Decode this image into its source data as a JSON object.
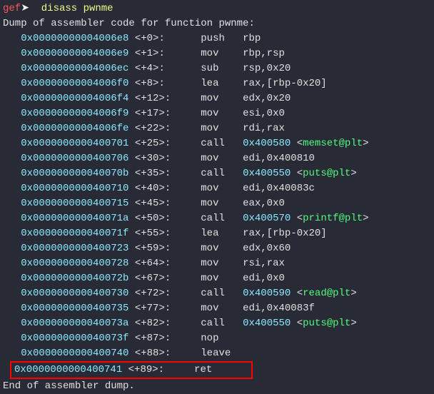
{
  "prompt": {
    "label": "gef",
    "arrow": "➤ ",
    "command": "disass pwnme"
  },
  "header": "Dump of assembler code for function pwnme:",
  "footer": "End of assembler dump.",
  "instructions": [
    {
      "addr": "0x00000000004006e8",
      "off": "<+0>:",
      "mn": "push",
      "op": "rbp",
      "call": null,
      "plt": null
    },
    {
      "addr": "0x00000000004006e9",
      "off": "<+1>:",
      "mn": "mov",
      "op": "rbp,rsp",
      "call": null,
      "plt": null
    },
    {
      "addr": "0x00000000004006ec",
      "off": "<+4>:",
      "mn": "sub",
      "op": "rsp,0x20",
      "call": null,
      "plt": null
    },
    {
      "addr": "0x00000000004006f0",
      "off": "<+8>:",
      "mn": "lea",
      "op": "rax,[rbp-0x20]",
      "call": null,
      "plt": null
    },
    {
      "addr": "0x00000000004006f4",
      "off": "<+12>:",
      "mn": "mov",
      "op": "edx,0x20",
      "call": null,
      "plt": null
    },
    {
      "addr": "0x00000000004006f9",
      "off": "<+17>:",
      "mn": "mov",
      "op": "esi,0x0",
      "call": null,
      "plt": null
    },
    {
      "addr": "0x00000000004006fe",
      "off": "<+22>:",
      "mn": "mov",
      "op": "rdi,rax",
      "call": null,
      "plt": null
    },
    {
      "addr": "0x0000000000400701",
      "off": "<+25>:",
      "mn": "call",
      "op": "",
      "call": "0x400580",
      "plt": "memset@plt"
    },
    {
      "addr": "0x0000000000400706",
      "off": "<+30>:",
      "mn": "mov",
      "op": "edi,0x400810",
      "call": null,
      "plt": null
    },
    {
      "addr": "0x000000000040070b",
      "off": "<+35>:",
      "mn": "call",
      "op": "",
      "call": "0x400550",
      "plt": "puts@plt"
    },
    {
      "addr": "0x0000000000400710",
      "off": "<+40>:",
      "mn": "mov",
      "op": "edi,0x40083c",
      "call": null,
      "plt": null
    },
    {
      "addr": "0x0000000000400715",
      "off": "<+45>:",
      "mn": "mov",
      "op": "eax,0x0",
      "call": null,
      "plt": null
    },
    {
      "addr": "0x000000000040071a",
      "off": "<+50>:",
      "mn": "call",
      "op": "",
      "call": "0x400570",
      "plt": "printf@plt"
    },
    {
      "addr": "0x000000000040071f",
      "off": "<+55>:",
      "mn": "lea",
      "op": "rax,[rbp-0x20]",
      "call": null,
      "plt": null
    },
    {
      "addr": "0x0000000000400723",
      "off": "<+59>:",
      "mn": "mov",
      "op": "edx,0x60",
      "call": null,
      "plt": null
    },
    {
      "addr": "0x0000000000400728",
      "off": "<+64>:",
      "mn": "mov",
      "op": "rsi,rax",
      "call": null,
      "plt": null
    },
    {
      "addr": "0x000000000040072b",
      "off": "<+67>:",
      "mn": "mov",
      "op": "edi,0x0",
      "call": null,
      "plt": null
    },
    {
      "addr": "0x0000000000400730",
      "off": "<+72>:",
      "mn": "call",
      "op": "",
      "call": "0x400590",
      "plt": "read@plt"
    },
    {
      "addr": "0x0000000000400735",
      "off": "<+77>:",
      "mn": "mov",
      "op": "edi,0x40083f",
      "call": null,
      "plt": null
    },
    {
      "addr": "0x000000000040073a",
      "off": "<+82>:",
      "mn": "call",
      "op": "",
      "call": "0x400550",
      "plt": "puts@plt"
    },
    {
      "addr": "0x000000000040073f",
      "off": "<+87>:",
      "mn": "nop",
      "op": "",
      "call": null,
      "plt": null
    },
    {
      "addr": "0x0000000000400740",
      "off": "<+88>:",
      "mn": "leave",
      "op": "",
      "call": null,
      "plt": null
    }
  ],
  "highlighted": {
    "addr": "0x0000000000400741",
    "off": "<+89>:",
    "mn": "ret",
    "op": ""
  }
}
